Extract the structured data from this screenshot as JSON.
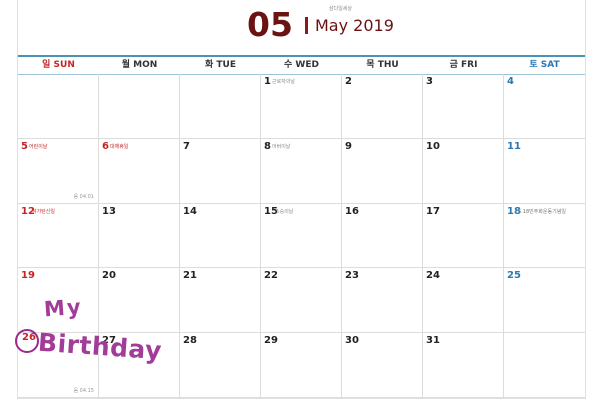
{
  "header": {
    "month_number": "05",
    "month_year": "May 2019",
    "tiny_note": "삼다일세상"
  },
  "weekdays": [
    "일 SUN",
    "월 MON",
    "화 TUE",
    "수 WED",
    "목 THU",
    "금 FRI",
    "토 SAT"
  ],
  "weeks": [
    [
      {
        "day": "",
        "note": "",
        "lunar": ""
      },
      {
        "day": "",
        "note": "",
        "lunar": ""
      },
      {
        "day": "",
        "note": "",
        "lunar": ""
      },
      {
        "day": "1",
        "note": "근로자의날",
        "lunar": ""
      },
      {
        "day": "2",
        "note": "",
        "lunar": ""
      },
      {
        "day": "3",
        "note": "",
        "lunar": ""
      },
      {
        "day": "4",
        "note": "",
        "lunar": ""
      }
    ],
    [
      {
        "day": "5",
        "note": "어린이날",
        "lunar": "음 04.01"
      },
      {
        "day": "6",
        "note": "대체휴일",
        "lunar": ""
      },
      {
        "day": "7",
        "note": "",
        "lunar": ""
      },
      {
        "day": "8",
        "note": "어버이날",
        "lunar": ""
      },
      {
        "day": "9",
        "note": "",
        "lunar": ""
      },
      {
        "day": "10",
        "note": "",
        "lunar": ""
      },
      {
        "day": "11",
        "note": "",
        "lunar": ""
      }
    ],
    [
      {
        "day": "12",
        "note": "석가탄신일",
        "lunar": ""
      },
      {
        "day": "13",
        "note": "",
        "lunar": ""
      },
      {
        "day": "14",
        "note": "",
        "lunar": ""
      },
      {
        "day": "15",
        "note": "스승의날",
        "lunar": ""
      },
      {
        "day": "16",
        "note": "",
        "lunar": ""
      },
      {
        "day": "17",
        "note": "",
        "lunar": ""
      },
      {
        "day": "18",
        "note": "5.18민주화운동기념일",
        "lunar": ""
      }
    ],
    [
      {
        "day": "19",
        "note": "",
        "lunar": ""
      },
      {
        "day": "20",
        "note": "",
        "lunar": ""
      },
      {
        "day": "21",
        "note": "",
        "lunar": ""
      },
      {
        "day": "22",
        "note": "",
        "lunar": ""
      },
      {
        "day": "23",
        "note": "",
        "lunar": ""
      },
      {
        "day": "24",
        "note": "",
        "lunar": ""
      },
      {
        "day": "25",
        "note": "",
        "lunar": ""
      }
    ],
    [
      {
        "day": "26",
        "note": "",
        "lunar": "음 04.15"
      },
      {
        "day": "27",
        "note": "",
        "lunar": ""
      },
      {
        "day": "28",
        "note": "",
        "lunar": ""
      },
      {
        "day": "29",
        "note": "",
        "lunar": ""
      },
      {
        "day": "30",
        "note": "",
        "lunar": ""
      },
      {
        "day": "31",
        "note": "",
        "lunar": ""
      },
      {
        "day": "",
        "note": "",
        "lunar": ""
      }
    ]
  ],
  "doodle": {
    "line1": "My",
    "line2": "Birthday"
  },
  "colors": {
    "accent": "#6b1212",
    "sunday": "#c32525",
    "saturday": "#2a79b5",
    "rule": "#4b93b4",
    "doodle": "#a23c98"
  }
}
